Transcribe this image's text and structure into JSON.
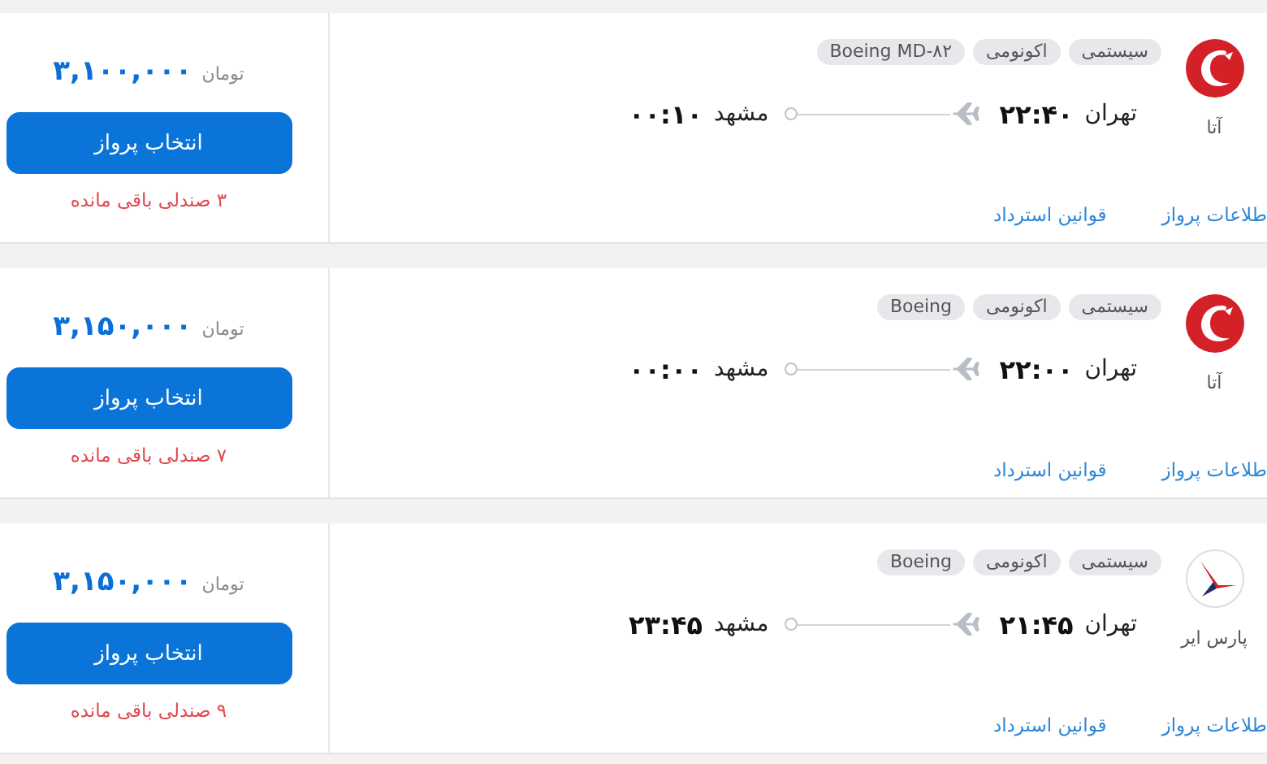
{
  "flights": [
    {
      "airline": "آتا",
      "logo": {
        "kind": "swirl"
      },
      "tags": [
        "سیستمی",
        "اکونومی",
        "Boeing MD-۸۲"
      ],
      "origin": "تهران",
      "departure": "۲۲:۴۰",
      "destination": "مشهد",
      "arrival": "۰۰:۱۰",
      "links": [
        "طلاعات پرواز",
        "قوانین استرداد"
      ],
      "price": "۳,۱۰۰,۰۰۰",
      "currency": "تومان",
      "button": "انتخاب پرواز",
      "seats": "۳ صندلی باقی مانده"
    },
    {
      "airline": "آتا",
      "logo": {
        "kind": "swirl"
      },
      "tags": [
        "سیستمی",
        "اکونومی",
        "Boeing"
      ],
      "origin": "تهران",
      "departure": "۲۲:۰۰",
      "destination": "مشهد",
      "arrival": "۰۰:۰۰",
      "links": [
        "طلاعات پرواز",
        "قوانین استرداد"
      ],
      "price": "۳,۱۵۰,۰۰۰",
      "currency": "تومان",
      "button": "انتخاب پرواز",
      "seats": "۷ صندلی باقی مانده"
    },
    {
      "airline": "پارس ایر",
      "logo": {
        "kind": "swoosh"
      },
      "tags": [
        "سیستمی",
        "اکونومی",
        "Boeing"
      ],
      "origin": "تهران",
      "departure": "۲۱:۴۵",
      "destination": "مشهد",
      "arrival": "۲۳:۴۵",
      "links": [
        "طلاعات پرواز",
        "قوانین استرداد"
      ],
      "price": "۳,۱۵۰,۰۰۰",
      "currency": "تومان",
      "button": "انتخاب پرواز",
      "seats": "۹ صندلی باقی مانده"
    }
  ]
}
